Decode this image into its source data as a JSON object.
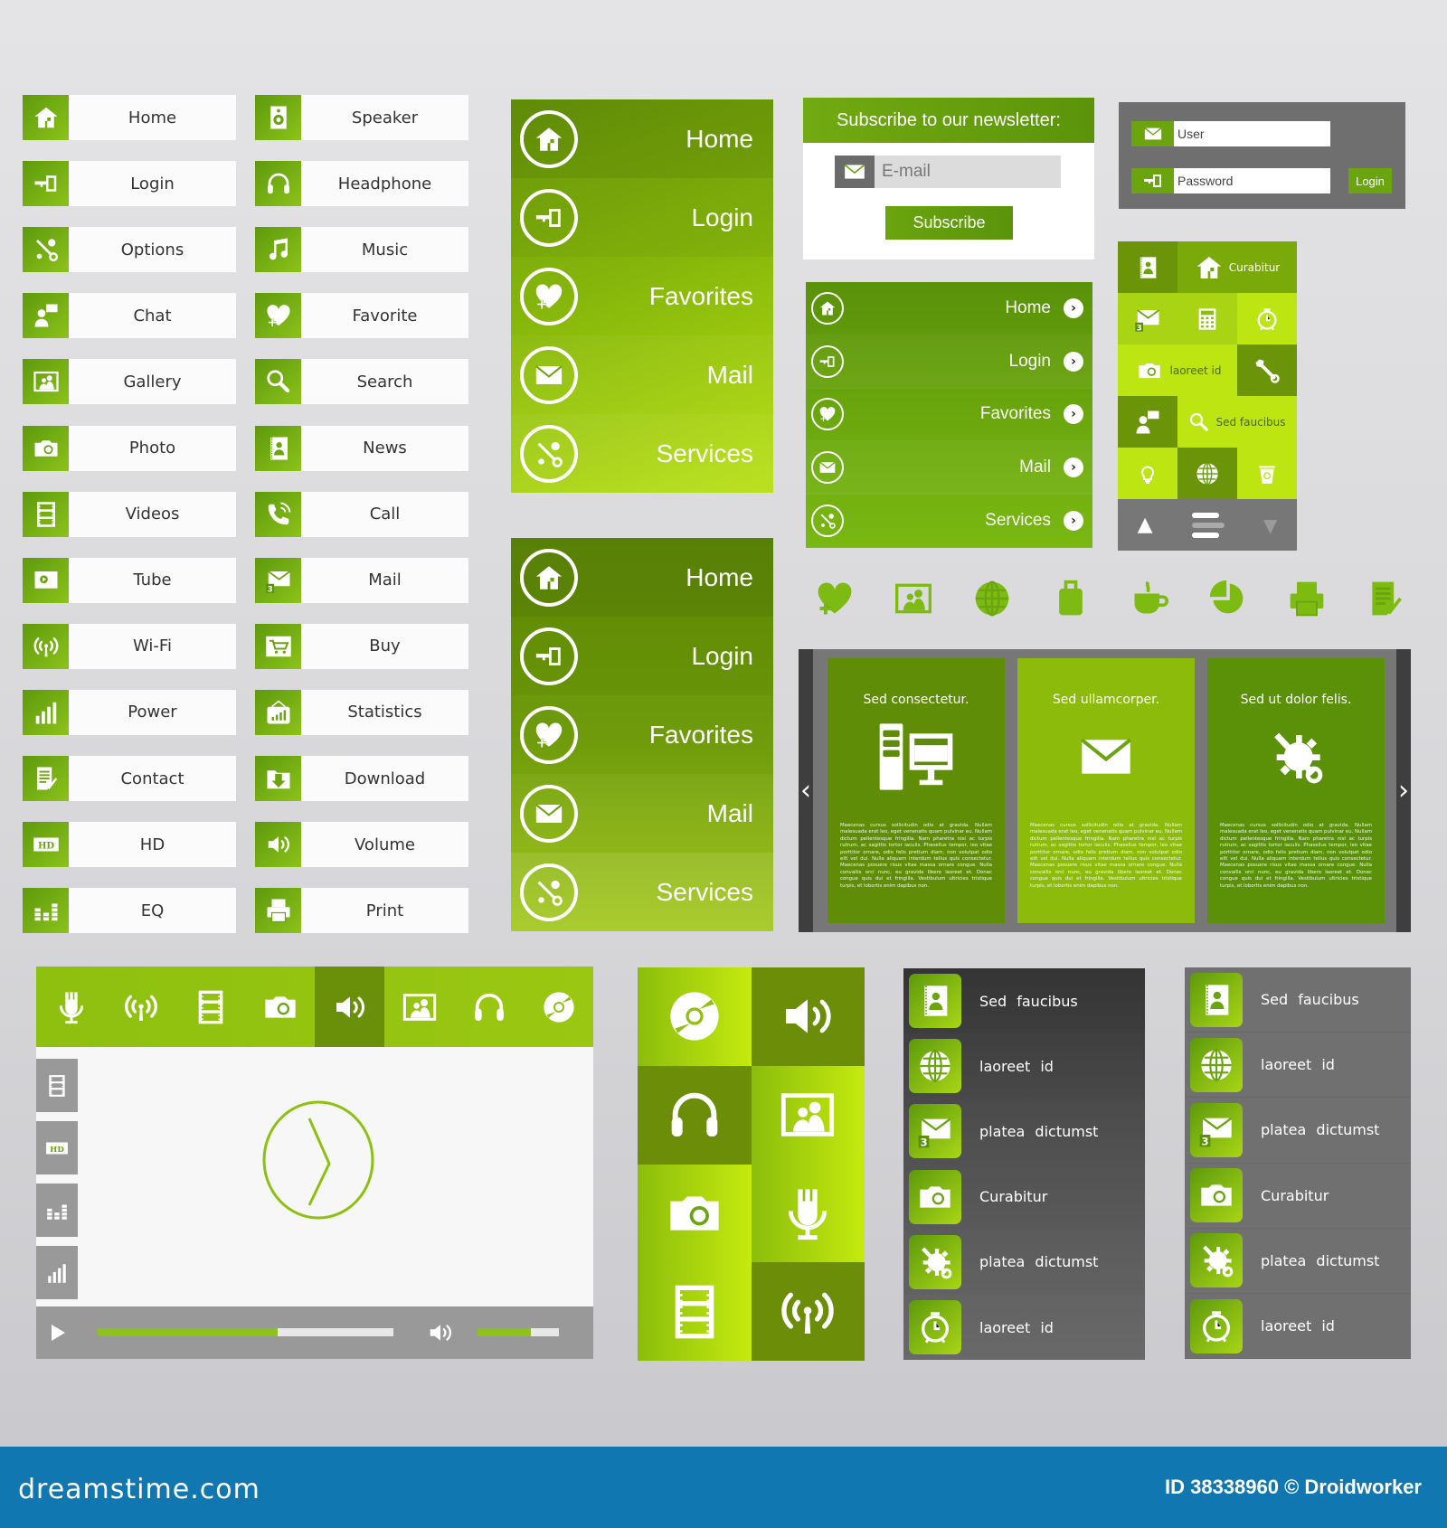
{
  "button_grid": {
    "column1": [
      {
        "label": "Home",
        "icon": "home-icon"
      },
      {
        "label": "Login",
        "icon": "key-icon"
      },
      {
        "label": "Options",
        "icon": "tools-icon"
      },
      {
        "label": "Chat",
        "icon": "chat-icon"
      },
      {
        "label": "Gallery",
        "icon": "gallery-icon"
      },
      {
        "label": "Photo",
        "icon": "camera-icon"
      },
      {
        "label": "Videos",
        "icon": "film-icon"
      },
      {
        "label": "Tube",
        "icon": "video-player-icon"
      },
      {
        "label": "Wi-Fi",
        "icon": "wifi-icon"
      },
      {
        "label": "Power",
        "icon": "signal-bars-icon"
      },
      {
        "label": "Contact",
        "icon": "document-pen-icon"
      },
      {
        "label": "HD",
        "icon": "hd-icon"
      },
      {
        "label": "EQ",
        "icon": "equalizer-icon"
      }
    ],
    "column2": [
      {
        "label": "Speaker",
        "icon": "speaker-icon"
      },
      {
        "label": "Headphone",
        "icon": "headphone-icon"
      },
      {
        "label": "Music",
        "icon": "music-note-icon"
      },
      {
        "label": "Favorite",
        "icon": "heart-plus-icon"
      },
      {
        "label": "Search",
        "icon": "magnifier-icon"
      },
      {
        "label": "News",
        "icon": "contact-book-icon"
      },
      {
        "label": "Call",
        "icon": "phone-icon"
      },
      {
        "label": "Mail",
        "icon": "mail-badge-icon"
      },
      {
        "label": "Buy",
        "icon": "cart-icon"
      },
      {
        "label": "Statistics",
        "icon": "chart-board-icon"
      },
      {
        "label": "Download",
        "icon": "download-folder-icon"
      },
      {
        "label": "Volume",
        "icon": "volume-icon"
      },
      {
        "label": "Print",
        "icon": "printer-icon"
      }
    ]
  },
  "green_menu_light": {
    "items": [
      {
        "label": "Home",
        "icon": "home-icon"
      },
      {
        "label": "Login",
        "icon": "key-icon"
      },
      {
        "label": "Favorites",
        "icon": "heart-plus-icon"
      },
      {
        "label": "Mail",
        "icon": "mail-icon"
      },
      {
        "label": "Services",
        "icon": "tools-icon"
      }
    ]
  },
  "green_menu_dark": {
    "items": [
      {
        "label": "Home",
        "icon": "home-icon"
      },
      {
        "label": "Login",
        "icon": "key-icon"
      },
      {
        "label": "Favorites",
        "icon": "heart-plus-icon"
      },
      {
        "label": "Mail",
        "icon": "mail-icon"
      },
      {
        "label": "Services",
        "icon": "tools-icon"
      }
    ]
  },
  "newsletter": {
    "title": "Subscribe to our newsletter:",
    "email_placeholder": "E-mail",
    "subscribe_label": "Subscribe"
  },
  "login_form": {
    "user_placeholder": "User",
    "password_placeholder": "Password",
    "login_label": "Login"
  },
  "small_menu": {
    "items": [
      {
        "label": "Home",
        "icon": "home-icon"
      },
      {
        "label": "Login",
        "icon": "key-icon"
      },
      {
        "label": "Favorites",
        "icon": "heart-plus-icon"
      },
      {
        "label": "Mail",
        "icon": "mail-icon"
      },
      {
        "label": "Services",
        "icon": "tools-icon"
      }
    ],
    "chevron": "›"
  },
  "tile_widget": {
    "tile_curabitur": "Curabitur",
    "tile_laoreet": "laoreet id",
    "tile_sed": "Sed faucibus",
    "nav_up": "▲",
    "nav_down": "▼"
  },
  "icon_row": [
    "heart-plus-icon",
    "gallery-icon",
    "globe-icon",
    "suitcase-icon",
    "coffee-cup-icon",
    "pie-chart-icon",
    "printer-icon",
    "document-pen-icon"
  ],
  "slider": {
    "cards": [
      {
        "title": "Sed consectetur.",
        "icon": "computer-icon",
        "body": "Maecenas cursus sollicitudin odio at gravida. Nullam malesuada erat leo, eget venenatis quam pulvinar eu. Nullam dictum pellentesque fringilla. Nam pharetra nisl ac turpis rutrum, ac sagittis tortor iaculis. Phasellus tempor, leo vitae porttitor ornare, odio felis pretium diam, non volutpat odio elit vel dui. Nulla aliquam interdum tellus quis consectetur. Maecenas posuere risus vitae massa ornare congue. Nulla convallis orci nunc, eu gravida libero laoreet et. Donec congue quis dui et fringilla. Vestibulum ultricies tristique turpis, et lobortis enim dapibus non."
      },
      {
        "title": "Sed ullamcorper.",
        "icon": "mail-icon",
        "body": "Maecenas cursus sollicitudin odio at gravida. Nullam malesuada erat leo, eget venenatis quam pulvinar eu. Nullam dictum pellentesque fringilla. Nam pharetra nisl ac turpis rutrum, ac sagittis tortor iaculis. Phasellus tempor, leo vitae porttitor ornare, odio felis pretium diam, non volutpat odio elit vel dui. Nulla aliquam interdum tellus quis consectetur. Maecenas posuere risus vitae massa ornare congue. Nulla convallis orci nunc, eu gravida libero laoreet et. Donec congue quis dui et fringilla. Vestibulum ultricies tristique turpis, et lobortis enim dapibus non."
      },
      {
        "title": "Sed ut dolor felis.",
        "icon": "tools-gear-icon",
        "body": "Maecenas cursus sollicitudin odio at gravida. Nullam malesuada erat leo, eget venenatis quam pulvinar eu. Nullam dictum pellentesque fringilla. Nam pharetra nisl ac turpis rutrum, ac sagittis tortor iaculis. Phasellus tempor, leo vitae porttitor ornare, odio felis pretium diam, non volutpat odio elit vel dui. Nulla aliquam interdum tellus quis consectetur. Maecenas posuere risus vitae massa ornare congue. Nulla convallis orci nunc, eu gravida libero laoreet et. Donec congue quis dui et fringilla. Vestibulum ultricies tristique turpis, et lobortis enim dapibus non."
      }
    ],
    "prev": "‹",
    "next": "›"
  },
  "media_player": {
    "toolbar_icons": [
      "microphone-icon",
      "wifi-icon",
      "film-icon",
      "camera-icon",
      "volume-icon",
      "gallery-icon",
      "headphone-icon",
      "disc-icon"
    ],
    "active_toolbar_index": 4,
    "side_icons": [
      "film-icon",
      "hd-icon",
      "equalizer-icon",
      "signal-bars-icon"
    ],
    "hd_text": "HD",
    "progress": 0.61,
    "volume": 0.65
  },
  "tile_grid": {
    "tiles": [
      "disc-icon",
      "volume-icon",
      "headphone-icon",
      "gallery-icon",
      "camera-icon",
      "microphone-icon",
      "film-icon",
      "wifi-icon"
    ]
  },
  "list_dark": {
    "items": [
      {
        "label": "Sed faucibus",
        "icon": "contact-book-icon"
      },
      {
        "label": "laoreet id",
        "icon": "globe-icon"
      },
      {
        "label": "platea dictumst",
        "icon": "mail-badge-icon"
      },
      {
        "label": "Curabitur",
        "icon": "camera-icon"
      },
      {
        "label": "platea dictumst",
        "icon": "tools-gear-icon"
      },
      {
        "label": "laoreet id",
        "icon": "alarm-clock-icon"
      }
    ]
  },
  "list_grey": {
    "items": [
      {
        "label": "Sed faucibus",
        "icon": "contact-book-icon"
      },
      {
        "label": "laoreet id",
        "icon": "globe-icon"
      },
      {
        "label": "platea dictumst",
        "icon": "mail-badge-icon"
      },
      {
        "label": "Curabitur",
        "icon": "camera-icon"
      },
      {
        "label": "platea dictumst",
        "icon": "tools-gear-icon"
      },
      {
        "label": "laoreet id",
        "icon": "alarm-clock-icon"
      }
    ]
  },
  "badge_count": "3",
  "footer": {
    "logo": "dreamstime.com",
    "credit": "ID 38338960 © Droidworker"
  },
  "colors": {
    "accent_green": "#6aa40f",
    "dark_green": "#5a8f08",
    "lime": "#bce512",
    "grey_panel": "#6f6f6f",
    "footer_blue": "#1077b0"
  }
}
